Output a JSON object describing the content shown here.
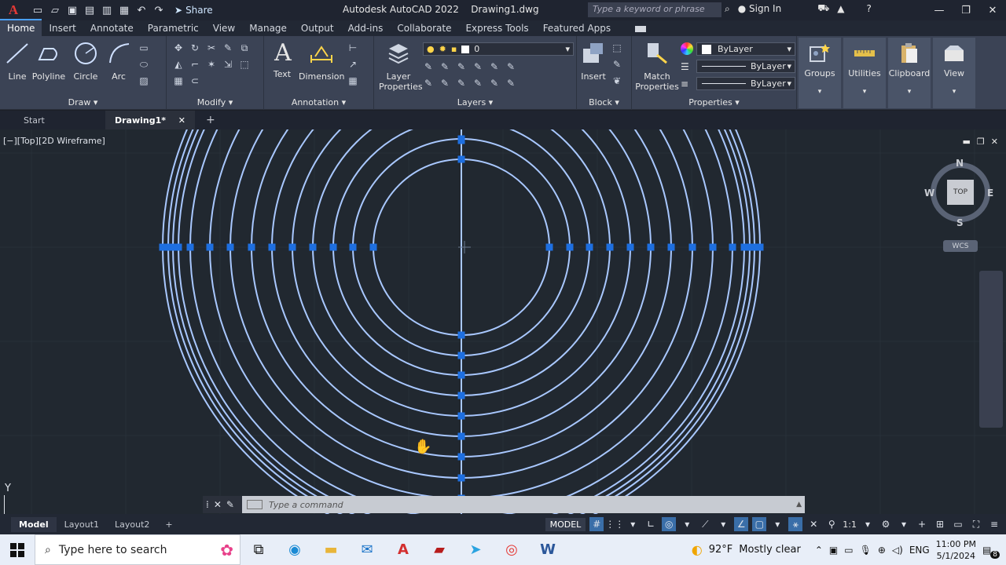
{
  "title_bar": {
    "app_title": "Autodesk AutoCAD 2022",
    "file_name": "Drawing1.dwg",
    "share_label": "Share",
    "search_placeholder": "Type a keyword or phrase",
    "sign_in_label": "Sign In"
  },
  "ribbon_tabs": [
    "Home",
    "Insert",
    "Annotate",
    "Parametric",
    "View",
    "Manage",
    "Output",
    "Add-ins",
    "Collaborate",
    "Express Tools",
    "Featured Apps"
  ],
  "ribbon": {
    "draw": {
      "title": "Draw",
      "line": "Line",
      "polyline": "Polyline",
      "circle": "Circle",
      "arc": "Arc"
    },
    "modify": {
      "title": "Modify"
    },
    "annotation": {
      "title": "Annotation",
      "text": "Text",
      "dimension": "Dimension"
    },
    "layers": {
      "title": "Layers",
      "layer_properties": "Layer Properties",
      "current_layer": "0"
    },
    "block": {
      "title": "Block",
      "insert": "Insert"
    },
    "properties": {
      "title": "Properties",
      "match_properties": "Match Properties",
      "color": "ByLayer",
      "linetype": "ByLayer",
      "lineweight": "ByLayer"
    },
    "groups": "Groups",
    "utilities": "Utilities",
    "clipboard": "Clipboard",
    "view": "View"
  },
  "file_tabs": {
    "start": "Start",
    "active": "Drawing1*"
  },
  "viewport": {
    "label": "[−][Top][2D Wireframe]",
    "viewcube": {
      "north": "N",
      "south": "S",
      "east": "E",
      "west": "W",
      "face": "TOP",
      "wcs": "WCS"
    },
    "ucs_y": "Y"
  },
  "command_line": {
    "placeholder": "Type a command"
  },
  "layout_tabs": [
    "Model",
    "Layout1",
    "Layout2"
  ],
  "status_bar": {
    "model": "MODEL",
    "scale": "1:1"
  },
  "taskbar": {
    "search_placeholder": "Type here to search",
    "weather_temp": "92°F",
    "weather_desc": "Mostly clear",
    "language": "ENG",
    "time": "11:00 PM",
    "date": "5/1/2024",
    "notification_count": "8"
  },
  "colors": {
    "accent": "#4aa0ff",
    "ribbon_bg": "#3b4355",
    "canvas_bg": "#212830",
    "geometry": "#a9c8ff",
    "grip": "#1e6fe0"
  }
}
